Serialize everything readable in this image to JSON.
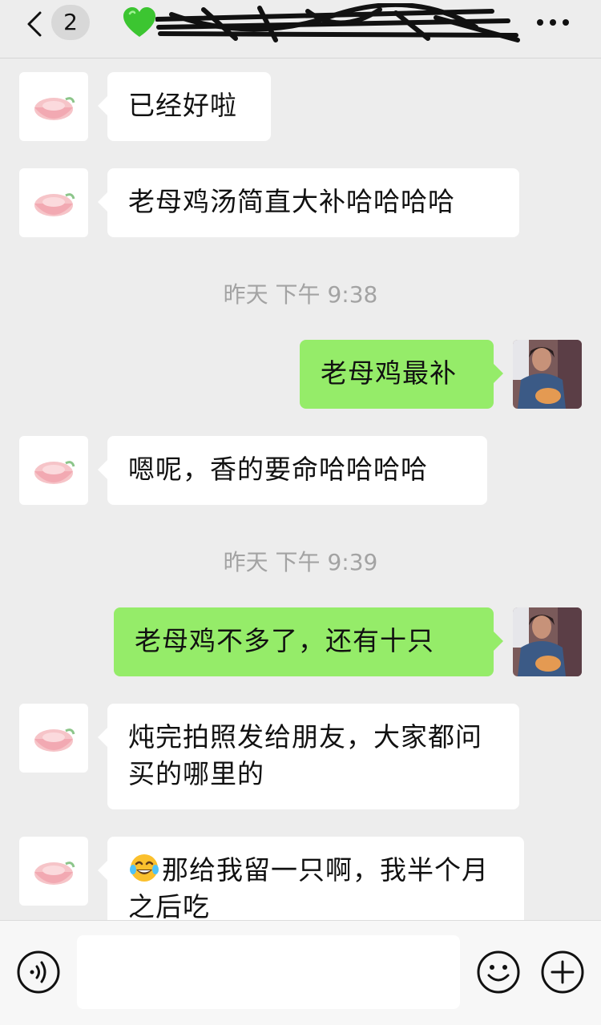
{
  "header": {
    "unread_count": "2",
    "title": "💚",
    "icons": {
      "back": "chevron-left-icon",
      "title_prefix": "green-heart-icon",
      "more": "more-dots-icon"
    }
  },
  "messages": [
    {
      "kind": "in",
      "text": "已经好啦"
    },
    {
      "kind": "in",
      "text": "老母鸡汤简直大补哈哈哈哈"
    },
    {
      "kind": "time",
      "text": "昨天 下午 9:38"
    },
    {
      "kind": "out",
      "text": "老母鸡最补"
    },
    {
      "kind": "in",
      "text": "嗯呢，香的要命哈哈哈哈"
    },
    {
      "kind": "time",
      "text": "昨天 下午 9:39"
    },
    {
      "kind": "out",
      "text": "老母鸡不多了，还有十只"
    },
    {
      "kind": "in",
      "text": "炖完拍照发给朋友，大家都问买的哪里的"
    },
    {
      "kind": "in",
      "emoji": "tears-of-joy-icon",
      "text": "那给我留一只啊，我半个月之后吃"
    }
  ],
  "footer": {
    "input_value": "",
    "icons": {
      "voice": "voice-icon",
      "emoji": "emoji-icon",
      "plus": "plus-icon"
    }
  },
  "colors": {
    "background": "#ededed",
    "outgoing_bubble": "#95ec69",
    "incoming_bubble": "#ffffff",
    "timestamp": "#a3a3a3"
  }
}
